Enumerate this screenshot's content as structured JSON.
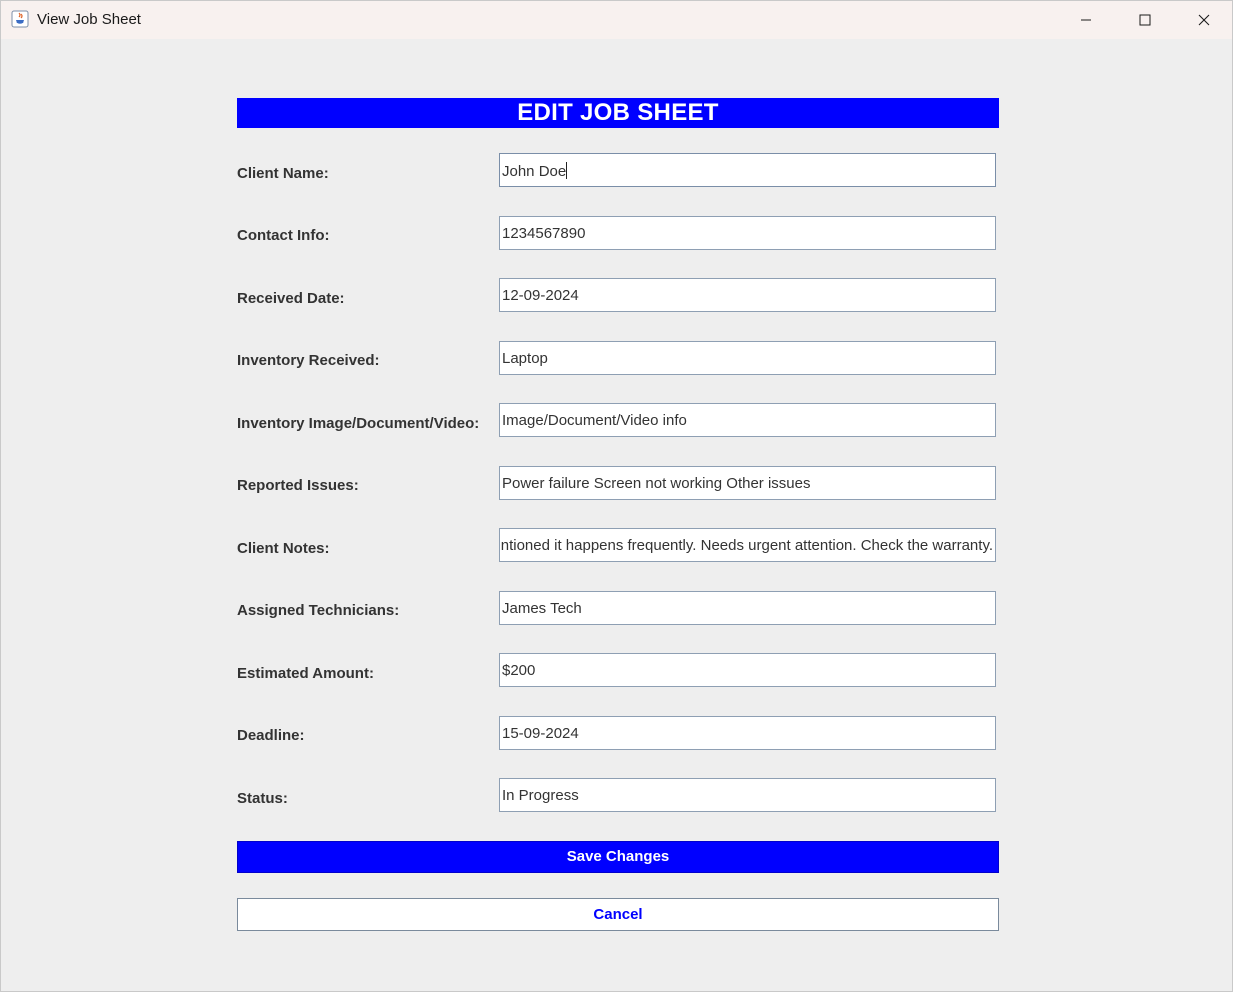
{
  "window": {
    "title": "View Job Sheet"
  },
  "form": {
    "heading": "EDIT JOB SHEET",
    "client_name": {
      "label": "Client Name:",
      "value": "John Doe"
    },
    "contact_info": {
      "label": "Contact Info:",
      "value": "1234567890"
    },
    "received_date": {
      "label": "Received Date:",
      "value": "12-09-2024"
    },
    "inventory_received": {
      "label": "Inventory Received:",
      "value": "Laptop"
    },
    "inventory_media": {
      "label": "Inventory Image/Document/Video:",
      "value": "Image/Document/Video info"
    },
    "reported_issues": {
      "label": "Reported Issues:",
      "value": "Power failure Screen not working Other issues"
    },
    "client_notes": {
      "label": "Client Notes:",
      "value": "nentioned it happens frequently. Needs urgent attention. Check the warranty."
    },
    "assigned_technicians": {
      "label": "Assigned Technicians:",
      "value": "James Tech"
    },
    "estimated_amount": {
      "label": "Estimated Amount:",
      "value": "$200"
    },
    "deadline": {
      "label": "Deadline:",
      "value": "15-09-2024"
    },
    "status": {
      "label": "Status:",
      "value": "In Progress"
    }
  },
  "actions": {
    "save_label": "Save Changes",
    "cancel_label": "Cancel"
  },
  "colors": {
    "accent": "#0000ff",
    "background": "#eeeeee"
  }
}
